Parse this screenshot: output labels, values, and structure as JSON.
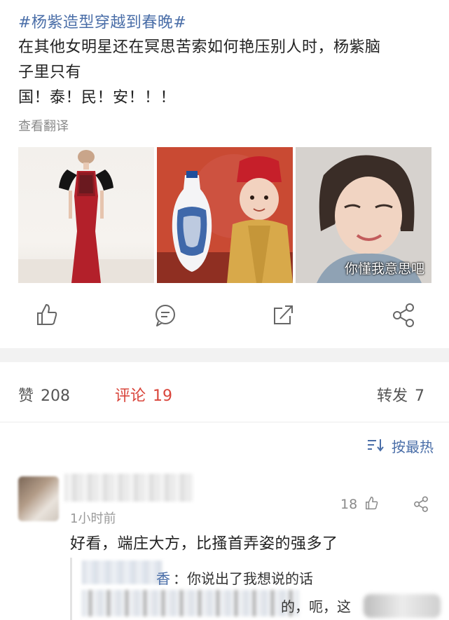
{
  "post": {
    "hashtag": "#杨紫造型穿越到春晚#",
    "body_lines": [
      "在其他女明星还在冥思苦索如何艳压别人时，杨紫脑",
      "子里只有",
      "国！泰！民！安！！！"
    ],
    "translate_label": "查看翻译",
    "images": [
      {
        "name": "red-gown-photo"
      },
      {
        "name": "child-with-vase-photo"
      },
      {
        "name": "smiling-face-photo",
        "caption": "你懂我意思吧"
      }
    ]
  },
  "actions": {
    "like_icon": "thumbs-up-icon",
    "comment_icon": "comment-icon",
    "repost_icon": "repost-icon",
    "share_icon": "share-icon"
  },
  "stats": {
    "likes_label": "赞",
    "likes_count": "208",
    "comments_label": "评论",
    "comments_count": "19",
    "reposts_label": "转发",
    "reposts_count": "7",
    "active_color": "#d9453b"
  },
  "sort": {
    "icon": "sort-icon",
    "label": "按最热"
  },
  "comment": {
    "time": "1小时前",
    "likes": "18",
    "text": "好看，端庄大方，比搔首弄姿的强多了",
    "reply1_name_tail": "香",
    "reply1_text": "：你说出了我想说的话",
    "reply2_text": "的，呃，这"
  },
  "colors": {
    "link_blue": "#4a6ea8",
    "muted": "#8a8a8a",
    "band": "#f2f2f2"
  }
}
